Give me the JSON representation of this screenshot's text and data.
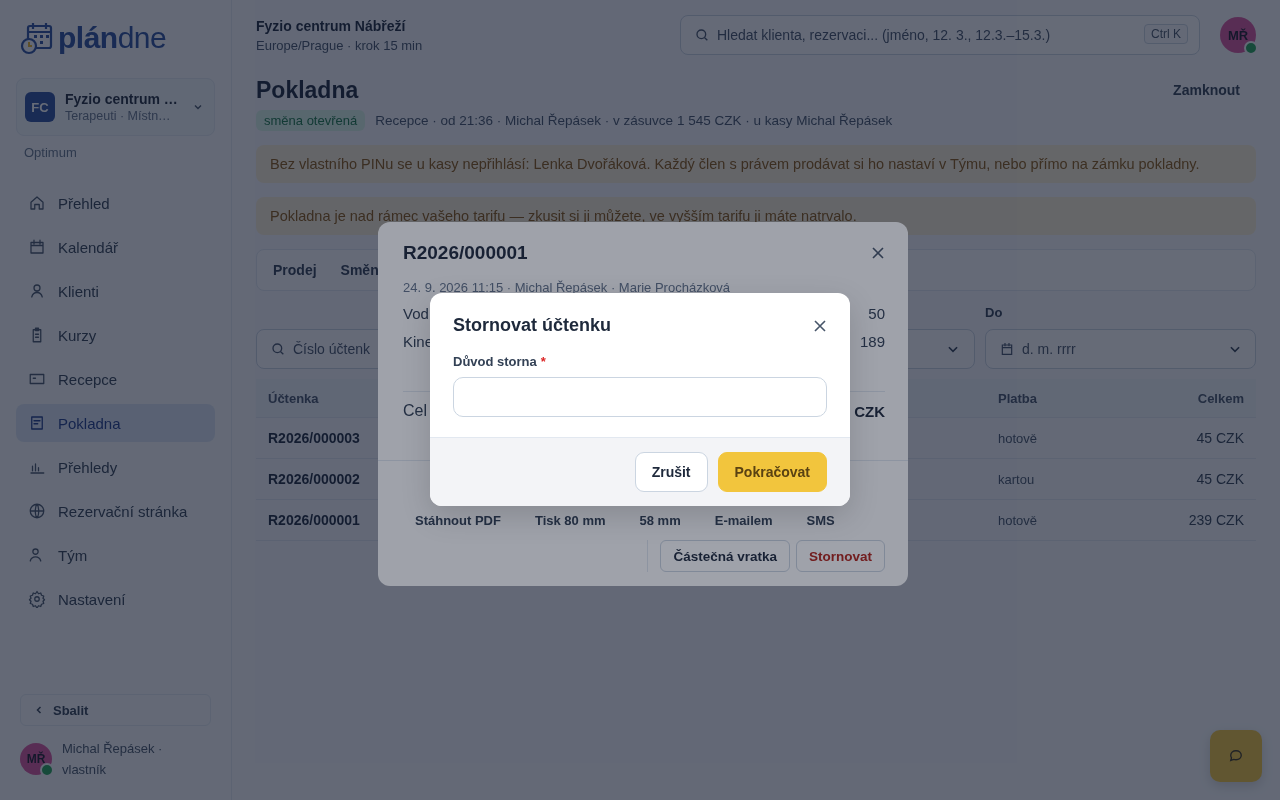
{
  "brand": {
    "text": "**plán**dne"
  },
  "workspace": {
    "initials": "FC",
    "name": "Fyzio centrum …",
    "subtitle": "Terapeuti · Místn…",
    "plan": "Optimum"
  },
  "nav": [
    {
      "label": "Přehled",
      "selected": false
    },
    {
      "label": "Kalendář",
      "selected": false
    },
    {
      "label": "Klienti",
      "selected": false
    },
    {
      "label": "Kurzy",
      "selected": false
    },
    {
      "label": "Recepce",
      "selected": false
    },
    {
      "label": "Pokladna",
      "selected": true
    },
    {
      "label": "Přehledy",
      "selected": false
    },
    {
      "label": "Rezervační stránka",
      "selected": false
    },
    {
      "label": "Tým",
      "selected": false
    },
    {
      "label": "Nastavení",
      "selected": false
    }
  ],
  "collapse_button": "Sbalit",
  "sidebar_user": {
    "initials": "MŘ",
    "name": "Michal Řepásek · vlastník",
    "online": true
  },
  "header": {
    "org": "Fyzio centrum Nábřeží",
    "subtitle": "Europe/Prague · krok 15 min",
    "search_placeholder": "Hledat klienta, rezervaci... (jméno, 12. 3., 12.3.–15.3.)",
    "shortcut": "Ctrl K",
    "avatar": "MŘ",
    "online": true
  },
  "page": {
    "title": "Pokladna",
    "lock_button": "Zamknout",
    "status_badge": "směna otevřená",
    "shift_info": "Recepce · od 21:36 · Michal Řepásek · v zásuvce 1 545 CZK · u kasy Michal Řepásek"
  },
  "banners": [
    "Bez vlastního PINu se u kasy nepřihlásí: Lenka Dvořáková. Každý člen s právem prodávat si ho nastaví v Týmu, nebo přímo na zámku pokladny.",
    "Pokladna je nad rámec vašeho tarifu — zkusit si ji můžete, ve vyšším tarifu ji máte natrvalo."
  ],
  "tabs": [
    {
      "label": "Prodej"
    },
    {
      "label": "Směn"
    }
  ],
  "filters": {
    "search_placeholder": "Číslo účtenk",
    "to_label": "Do",
    "date_placeholder": "d. m. rrrr"
  },
  "table": {
    "columns": [
      "Účtenka",
      "Platba",
      "Celkem"
    ],
    "rows": [
      {
        "receipt": "R2026/000003",
        "payment": "hotově",
        "total": "45 CZK"
      },
      {
        "receipt": "R2026/000002",
        "payment": "kartou",
        "total": "45 CZK"
      },
      {
        "receipt": "R2026/000001",
        "payment": "hotově",
        "total": "239 CZK"
      }
    ]
  },
  "receipt_modal": {
    "number": "R2026/000001",
    "meta": "24. 9. 2026 11:15 · Michal Řepásek · Marie Procházková",
    "items": [
      {
        "name": "Vod",
        "amount": "50"
      },
      {
        "name": "Kine",
        "amount": "189"
      }
    ],
    "total_label": "Cel",
    "total_value": "CZK",
    "share_actions": [
      "Stáhnout PDF",
      "Tisk 80 mm",
      "58 mm",
      "E-mailem",
      "SMS"
    ],
    "actions": [
      {
        "label": "Částečná vratka",
        "kind": "default"
      },
      {
        "label": "Stornovat",
        "kind": "danger"
      }
    ]
  },
  "void_dialog": {
    "title": "Stornovat účtenku",
    "field_label": "Důvod storna",
    "required_mark": "*",
    "buttons": [
      {
        "label": "Zrušit",
        "kind": "secondary"
      },
      {
        "label": "Pokračovat",
        "kind": "primary"
      }
    ]
  }
}
